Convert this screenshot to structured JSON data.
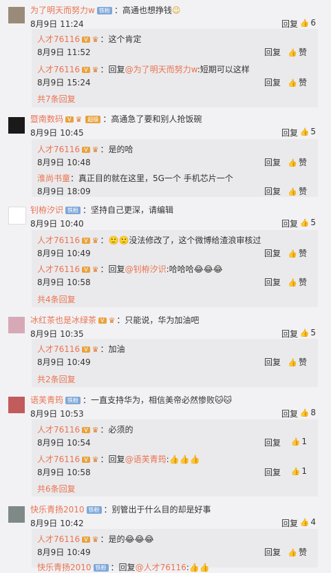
{
  "common": {
    "reply": "回复",
    "zan": "赞",
    "vip_label": "超级",
    "v_label": "V"
  },
  "c1": {
    "user": "为了明天而努力w",
    "badge": "铁粉",
    "text": "：高通也想挣钱",
    "time": "8月9日 11:24",
    "likes": "6",
    "subs": [
      {
        "user": "人才76116",
        "text": "：这个肯定",
        "time": "8月9日 11:52"
      },
      {
        "user": "人才76116",
        "text_pre": "：回复",
        "mention": "@为了明天而努力w",
        "text": ":短期可以这样",
        "time": "8月9日 15:24"
      }
    ],
    "more": "共7条回复"
  },
  "c2": {
    "user": "暨南数码",
    "badge": "超级",
    "text": "：高通急了要和别人抢饭碗",
    "time": "8月9日 10:45",
    "likes": "5",
    "subs": [
      {
        "user": "人才76116",
        "text": "：是的哈",
        "time": "8月9日 10:48"
      },
      {
        "user": "淮尚书童",
        "text": "：真正目的就在这里，5G一个 手机芯片一个",
        "time": "8月9日 18:09"
      }
    ]
  },
  "c3": {
    "user": "钊栫汐识",
    "badge": "铁粉",
    "text": "：坚持自己更深，请编辑",
    "time": "8月9日 10:40",
    "likes": "5",
    "subs": [
      {
        "user": "人才76116",
        "text": "：🙂🙂没法修改了，这个微博给渣浪审核过",
        "time": "8月9日 10:49"
      },
      {
        "user": "人才76116",
        "text_pre": "：回复",
        "mention": "@钊栫汐识",
        "text": ":哈哈哈😂😂😂",
        "time": "8月9日 10:58"
      }
    ],
    "more": "共4条回复"
  },
  "c4": {
    "user": "冰红茶也是冰绿茶",
    "text": "：只能说，华为加油吧",
    "time": "8月9日 10:35",
    "likes": "5",
    "subs": [
      {
        "user": "人才76116",
        "text": "：加油",
        "time": "8月9日 10:49"
      }
    ],
    "more": "共2条回复"
  },
  "c5": {
    "user": "语芙青筠",
    "badge": "铁粉",
    "text": "：一直支持华为，相信美帝必然惨败🐱🐱",
    "time": "8月9日 10:53",
    "likes": "8",
    "subs": [
      {
        "user": "人才76116",
        "text": "：必须的",
        "time": "8月9日 10:54",
        "likes": "1"
      },
      {
        "user": "人才76116",
        "text_pre": "：回复",
        "mention": "@语芙青筠",
        "text": ":👍👍👍",
        "time": "8月9日 10:58",
        "likes": "1"
      }
    ],
    "more": "共6条回复"
  },
  "c6": {
    "user": "快乐青扬2010",
    "badge": "铁粉",
    "text": "：别管出于什么目的却是好事",
    "time": "8月9日 10:42",
    "likes": "4",
    "subs": [
      {
        "user": "人才76116",
        "text": "：是的😂😂😂",
        "time": "8月9日 10:49"
      }
    ],
    "trail": {
      "user": "快乐青扬2010",
      "badge": "铁粉",
      "text_pre": "：回复",
      "mention": "@人才76116",
      "text": ":👍👍"
    }
  }
}
